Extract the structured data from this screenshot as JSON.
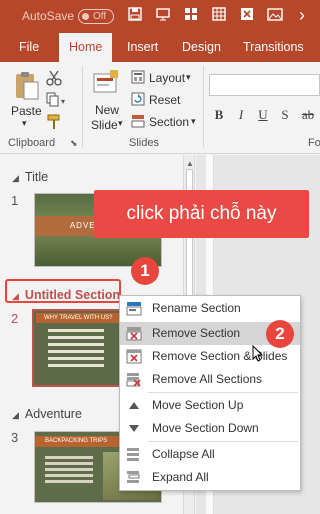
{
  "title_bar": {
    "autosave_label": "AutoSave",
    "autosave_state": "Off",
    "icons": [
      "save-icon",
      "present-icon",
      "grid-icon",
      "table-icon",
      "close-box-icon",
      "picture-icon"
    ],
    "background_color": "#b7472a"
  },
  "tabs": [
    {
      "label": "File",
      "active": false
    },
    {
      "label": "Home",
      "active": true
    },
    {
      "label": "Insert",
      "active": false
    },
    {
      "label": "Design",
      "active": false
    },
    {
      "label": "Transitions",
      "active": false
    }
  ],
  "ribbon": {
    "clipboard": {
      "paste_label": "Paste",
      "group_label": "Clipboard"
    },
    "slides": {
      "new_slide_label_1": "New",
      "new_slide_label_2": "Slide",
      "layout_label": "Layout",
      "reset_label": "Reset",
      "section_label": "Section",
      "group_label": "Slides"
    },
    "font": {
      "format_letters": [
        "B",
        "I",
        "U",
        "S",
        "ab"
      ],
      "group_label": "Fo"
    }
  },
  "slide_pane": {
    "sections": [
      {
        "name": "Title",
        "slides": [
          {
            "number": "1",
            "thumb_text": "ADVENTURE"
          }
        ]
      },
      {
        "name": "Untitled Section",
        "slides": [
          {
            "number": "2",
            "thumb_text": "WHY TRAVEL WITH US?"
          }
        ]
      },
      {
        "name": "Adventure",
        "slides": [
          {
            "number": "3",
            "thumb_text": "BACKPACKING TRIPS"
          }
        ]
      }
    ]
  },
  "annotations": {
    "callout_text": "click phải chỗ này",
    "badge_1": "1",
    "badge_2": "2",
    "accent_color": "#e8453c"
  },
  "context_menu": {
    "items": [
      {
        "label": "Rename Section",
        "icon": "rename-section-icon"
      },
      {
        "label": "Remove Section",
        "icon": "remove-section-icon",
        "hover": true
      },
      {
        "label": "Remove Section & Slides",
        "icon": "remove-section-slides-icon"
      },
      {
        "label": "Remove All Sections",
        "icon": "remove-all-sections-icon"
      },
      {
        "label": "Move Section Up",
        "icon": "triangle-up-icon"
      },
      {
        "label": "Move Section Down",
        "icon": "triangle-down-icon"
      },
      {
        "label": "Collapse All",
        "icon": "collapse-all-icon"
      },
      {
        "label": "Expand All",
        "icon": "expand-all-icon"
      }
    ]
  }
}
